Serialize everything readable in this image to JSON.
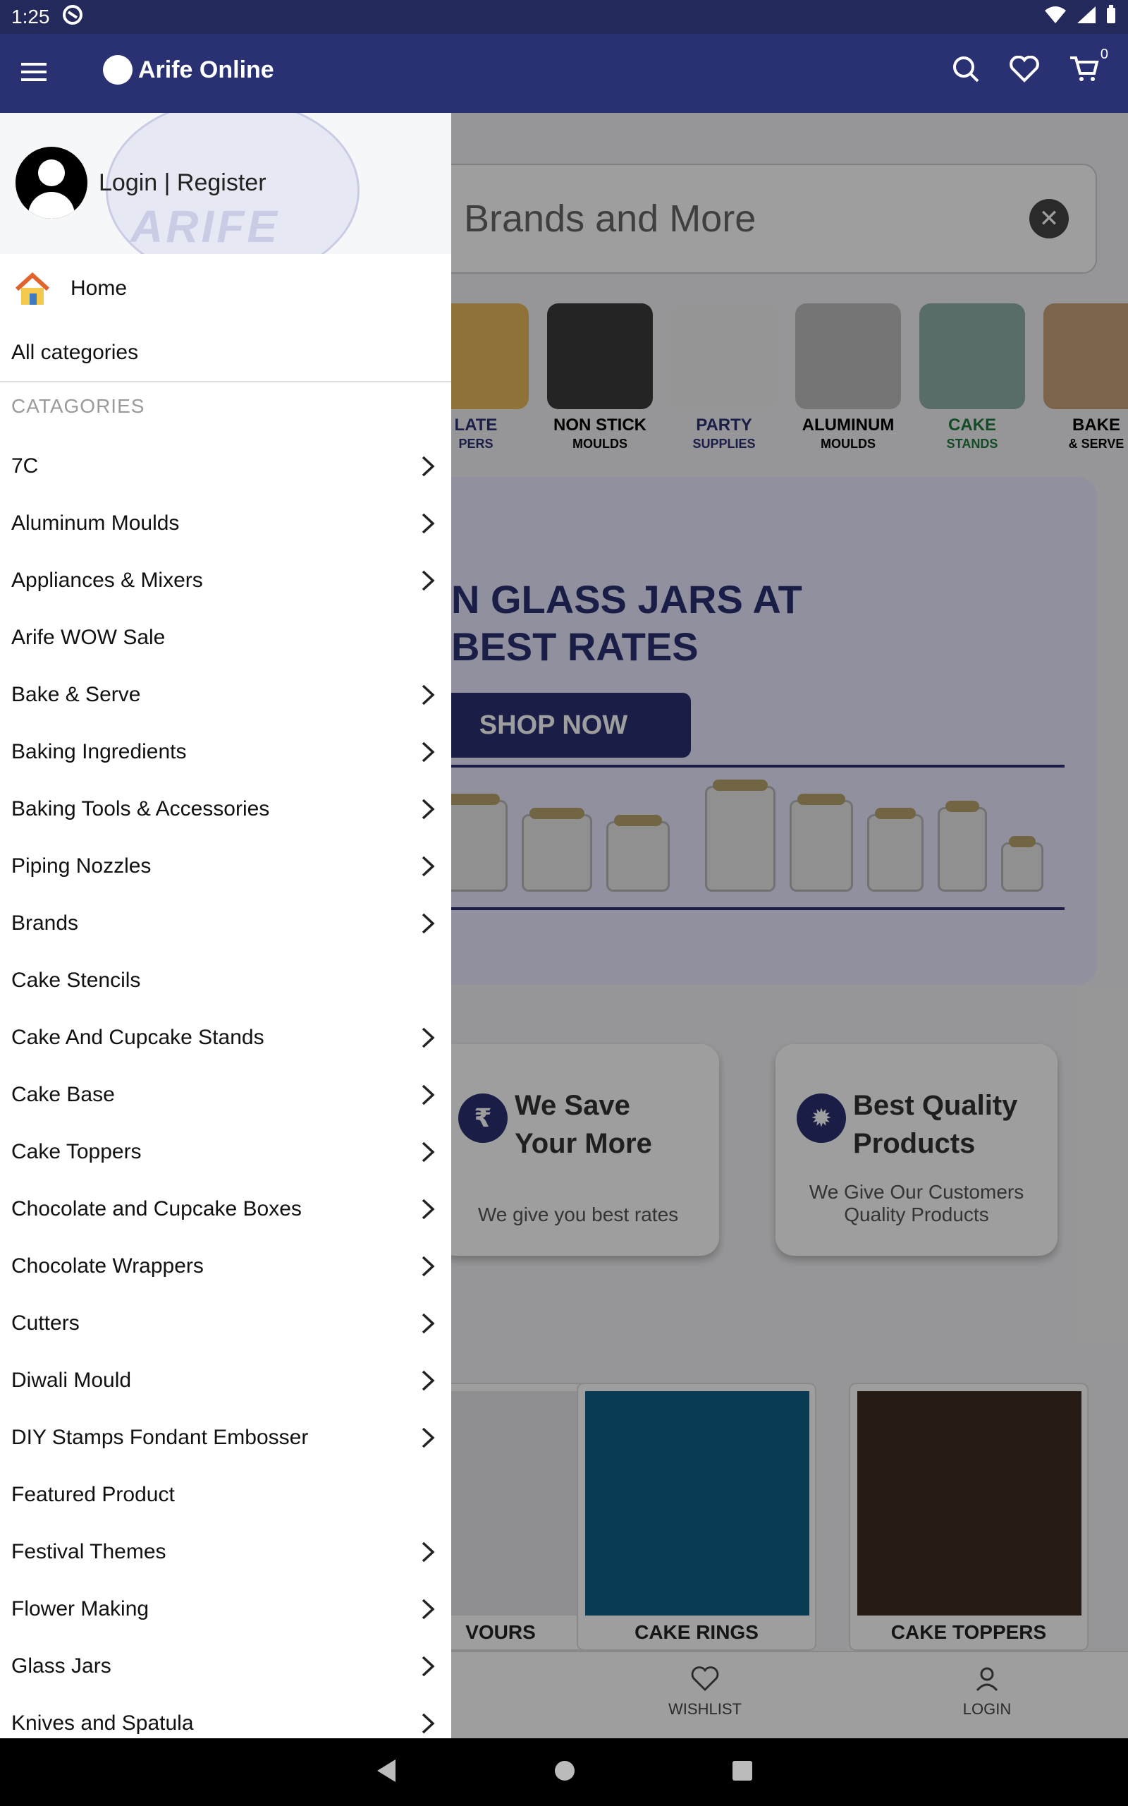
{
  "status": {
    "time": "1:25"
  },
  "appbar": {
    "brand": "Arife Online",
    "cart_count": "0"
  },
  "search": {
    "placeholder": "Brands and More"
  },
  "categories_strip": [
    {
      "label": "LATE",
      "sub": "PERS"
    },
    {
      "label": "NON STICK",
      "sub": "MOULDS"
    },
    {
      "label": "PARTY",
      "sub": "SUPPLIES"
    },
    {
      "label": "ALUMINUM",
      "sub": "MOULDS"
    },
    {
      "label": "CAKE",
      "sub": "STANDS"
    },
    {
      "label": "BAKE",
      "sub": "& SERVE"
    }
  ],
  "banner": {
    "headline1": "N GLASS JARS AT",
    "headline2": "BEST RATES",
    "button": "SHOP NOW"
  },
  "features": [
    {
      "title1": "We Save",
      "title2": "Your More",
      "desc": "We give you best rates",
      "icon": "₹"
    },
    {
      "title1": "Best Quality",
      "title2": "Products",
      "desc1": "We Give Our Customers",
      "desc2": "Quality Products",
      "icon": "✹"
    }
  ],
  "products": [
    "VOURS",
    "CAKE RINGS",
    "CAKE TOPPERS"
  ],
  "bottom_nav": {
    "wishlist": "WISHLIST",
    "login": "LOGIN"
  },
  "drawer": {
    "login": "Login | Register",
    "home": "Home",
    "all_categories": "All categories",
    "section_title": "CATAGORIES",
    "items": [
      {
        "label": "7C",
        "chevron": true
      },
      {
        "label": "Aluminum Moulds",
        "chevron": true
      },
      {
        "label": "Appliances & Mixers",
        "chevron": true
      },
      {
        "label": "Arife WOW Sale",
        "chevron": false
      },
      {
        "label": "Bake & Serve",
        "chevron": true
      },
      {
        "label": "Baking Ingredients",
        "chevron": true
      },
      {
        "label": "Baking Tools & Accessories",
        "chevron": true
      },
      {
        "label": "Piping Nozzles",
        "chevron": true
      },
      {
        "label": "Brands",
        "chevron": true
      },
      {
        "label": "Cake Stencils",
        "chevron": false
      },
      {
        "label": "Cake And Cupcake Stands",
        "chevron": true
      },
      {
        "label": "Cake Base",
        "chevron": true
      },
      {
        "label": "Cake Toppers",
        "chevron": true
      },
      {
        "label": "Chocolate and Cupcake Boxes",
        "chevron": true
      },
      {
        "label": "Chocolate Wrappers",
        "chevron": true
      },
      {
        "label": "Cutters",
        "chevron": true
      },
      {
        "label": "Diwali Mould",
        "chevron": true
      },
      {
        "label": "DIY Stamps Fondant Embosser",
        "chevron": true
      },
      {
        "label": "Featured Product",
        "chevron": false
      },
      {
        "label": "Festival Themes",
        "chevron": true
      },
      {
        "label": "Flower Making",
        "chevron": true
      },
      {
        "label": "Glass Jars",
        "chevron": true
      },
      {
        "label": "Knives and Spatula",
        "chevron": true
      }
    ]
  }
}
